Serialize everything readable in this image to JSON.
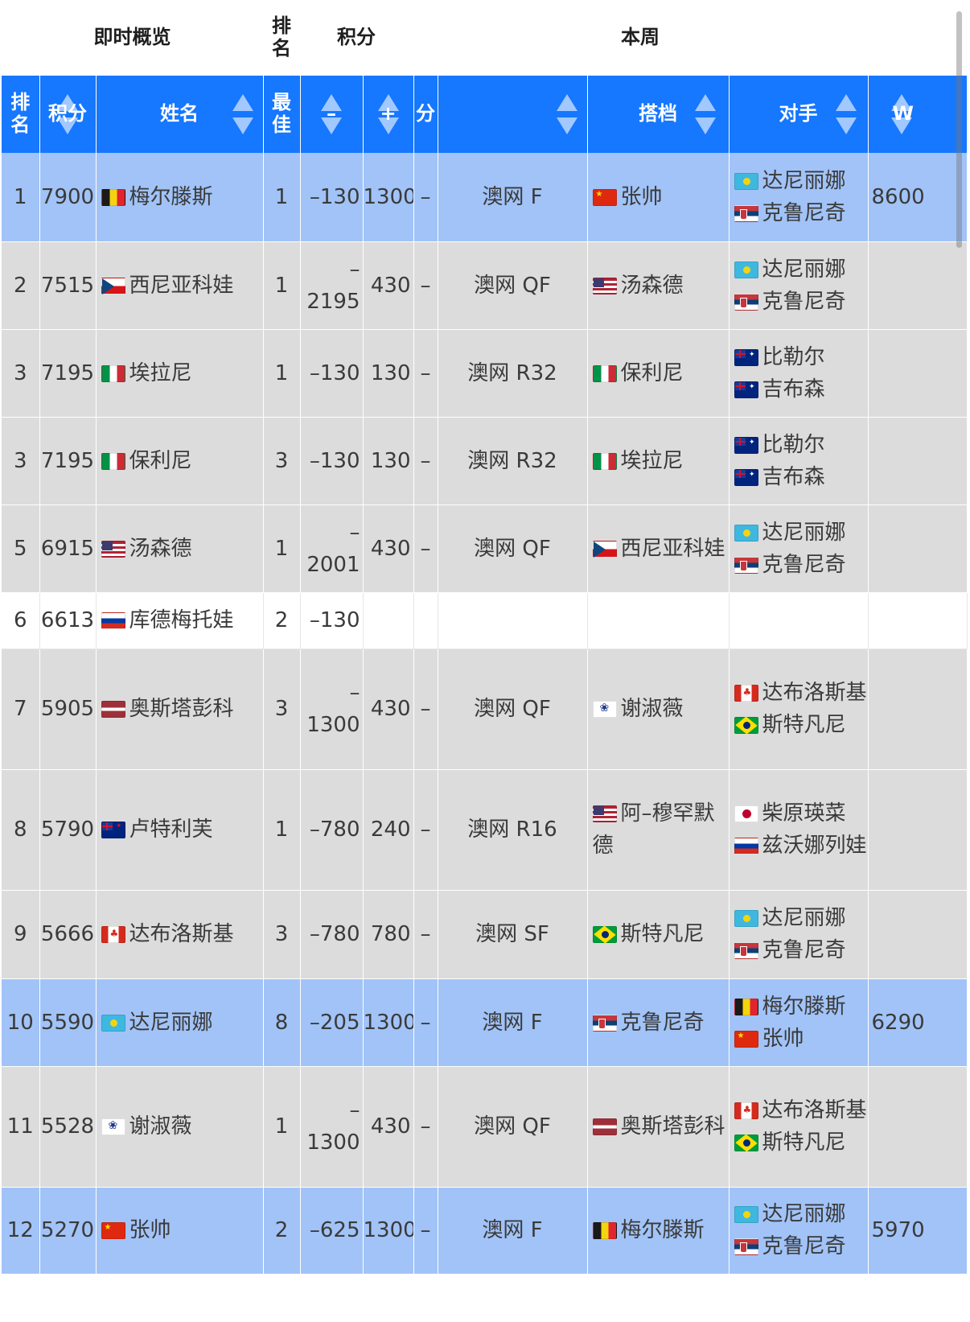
{
  "group_headers": {
    "overview": "即时概览",
    "rank": "排名",
    "points": "积分",
    "this_week": "本周"
  },
  "columns": {
    "rank": "排名",
    "points": "积分",
    "name": "姓名",
    "best": "最佳",
    "minus": "–",
    "plus": "+",
    "score": "分",
    "event": "",
    "partner": "搭档",
    "opponent": "对手",
    "w": "W"
  },
  "rows": [
    {
      "style": "blue",
      "rank": "1",
      "points": "7900",
      "flag": "be",
      "name": "梅尔滕斯",
      "best": "1",
      "minus": "–130",
      "plus": "1300",
      "dash": "–",
      "event": "澳网 F",
      "partner_flag": "cn",
      "partner": "张帅",
      "opponents": [
        {
          "flag": "kz",
          "name": "达尼丽娜"
        },
        {
          "flag": "rs",
          "name": "克鲁尼奇"
        }
      ],
      "w": "8600"
    },
    {
      "style": "gray",
      "rank": "2",
      "points": "7515",
      "flag": "cz",
      "name": "西尼亚科娃",
      "best": "1",
      "minus": "–2195",
      "plus": "430",
      "dash": "–",
      "event": "澳网 QF",
      "partner_flag": "us",
      "partner": "汤森德",
      "opponents": [
        {
          "flag": "kz",
          "name": "达尼丽娜"
        },
        {
          "flag": "rs",
          "name": "克鲁尼奇"
        }
      ],
      "w": ""
    },
    {
      "style": "gray",
      "rank": "3",
      "points": "7195",
      "flag": "it",
      "name": "埃拉尼",
      "best": "1",
      "minus": "–130",
      "plus": "130",
      "dash": "–",
      "event": "澳网 R32",
      "partner_flag": "it",
      "partner": "保利尼",
      "opponents": [
        {
          "flag": "au",
          "name": "比勒尔"
        },
        {
          "flag": "au",
          "name": "吉布森"
        }
      ],
      "w": ""
    },
    {
      "style": "gray",
      "rank": "3",
      "points": "7195",
      "flag": "it",
      "name": "保利尼",
      "best": "3",
      "minus": "–130",
      "plus": "130",
      "dash": "–",
      "event": "澳网 R32",
      "partner_flag": "it",
      "partner": "埃拉尼",
      "opponents": [
        {
          "flag": "au",
          "name": "比勒尔"
        },
        {
          "flag": "au",
          "name": "吉布森"
        }
      ],
      "w": ""
    },
    {
      "style": "gray",
      "rank": "5",
      "points": "6915",
      "flag": "us",
      "name": "汤森德",
      "best": "1",
      "minus": "–2001",
      "plus": "430",
      "dash": "–",
      "event": "澳网 QF",
      "partner_flag": "cz",
      "partner": "西尼亚科娃",
      "opponents": [
        {
          "flag": "kz",
          "name": "达尼丽娜"
        },
        {
          "flag": "rs",
          "name": "克鲁尼奇"
        }
      ],
      "w": ""
    },
    {
      "style": "white",
      "rank": "6",
      "points": "6613",
      "flag": "ru",
      "name": "库德梅托娃",
      "best": "2",
      "minus": "–130",
      "plus": "",
      "dash": "",
      "event": "",
      "partner_flag": "",
      "partner": "",
      "opponents": [],
      "w": ""
    },
    {
      "style": "gray",
      "rank": "7",
      "points": "5905",
      "flag": "lv",
      "name": "奥斯塔彭科",
      "best": "3",
      "minus": "–1300",
      "plus": "430",
      "dash": "–",
      "event": "澳网 QF",
      "partner_flag": "tw",
      "partner": "谢淑薇",
      "opponents": [
        {
          "flag": "ca",
          "name": "达布洛斯基"
        },
        {
          "flag": "br",
          "name": "斯特凡尼"
        }
      ],
      "w": ""
    },
    {
      "style": "gray",
      "rank": "8",
      "points": "5790",
      "flag": "nz",
      "name": "卢特利芙",
      "best": "1",
      "minus": "–780",
      "plus": "240",
      "dash": "–",
      "event": "澳网 R16",
      "partner_flag": "us",
      "partner": "阿–穆罕默德",
      "opponents": [
        {
          "flag": "jp",
          "name": "柴原瑛菜"
        },
        {
          "flag": "ru",
          "name": "兹沃娜列娃"
        }
      ],
      "w": ""
    },
    {
      "style": "gray",
      "rank": "9",
      "points": "5666",
      "flag": "ca",
      "name": "达布洛斯基",
      "best": "3",
      "minus": "–780",
      "plus": "780",
      "dash": "–",
      "event": "澳网 SF",
      "partner_flag": "br",
      "partner": "斯特凡尼",
      "opponents": [
        {
          "flag": "kz",
          "name": "达尼丽娜"
        },
        {
          "flag": "rs",
          "name": "克鲁尼奇"
        }
      ],
      "w": ""
    },
    {
      "style": "blue",
      "rank": "10",
      "points": "5590",
      "flag": "kz",
      "name": "达尼丽娜",
      "best": "8",
      "minus": "–205",
      "plus": "1300",
      "dash": "–",
      "event": "澳网 F",
      "partner_flag": "rs",
      "partner": "克鲁尼奇",
      "opponents": [
        {
          "flag": "be",
          "name": "梅尔滕斯"
        },
        {
          "flag": "cn",
          "name": "张帅"
        }
      ],
      "w": "6290"
    },
    {
      "style": "gray",
      "rank": "11",
      "points": "5528",
      "flag": "tw",
      "name": "谢淑薇",
      "best": "1",
      "minus": "–1300",
      "plus": "430",
      "dash": "–",
      "event": "澳网 QF",
      "partner_flag": "lv",
      "partner": "奥斯塔彭科",
      "opponents": [
        {
          "flag": "ca",
          "name": "达布洛斯基"
        },
        {
          "flag": "br",
          "name": "斯特凡尼"
        }
      ],
      "w": ""
    },
    {
      "style": "blue",
      "rank": "12",
      "points": "5270",
      "flag": "cn",
      "name": "张帅",
      "best": "2",
      "minus": "–625",
      "plus": "1300",
      "dash": "–",
      "event": "澳网 F",
      "partner_flag": "be",
      "partner": "梅尔滕斯",
      "opponents": [
        {
          "flag": "kz",
          "name": "达尼丽娜"
        },
        {
          "flag": "rs",
          "name": "克鲁尼奇"
        }
      ],
      "w": "5970"
    }
  ]
}
